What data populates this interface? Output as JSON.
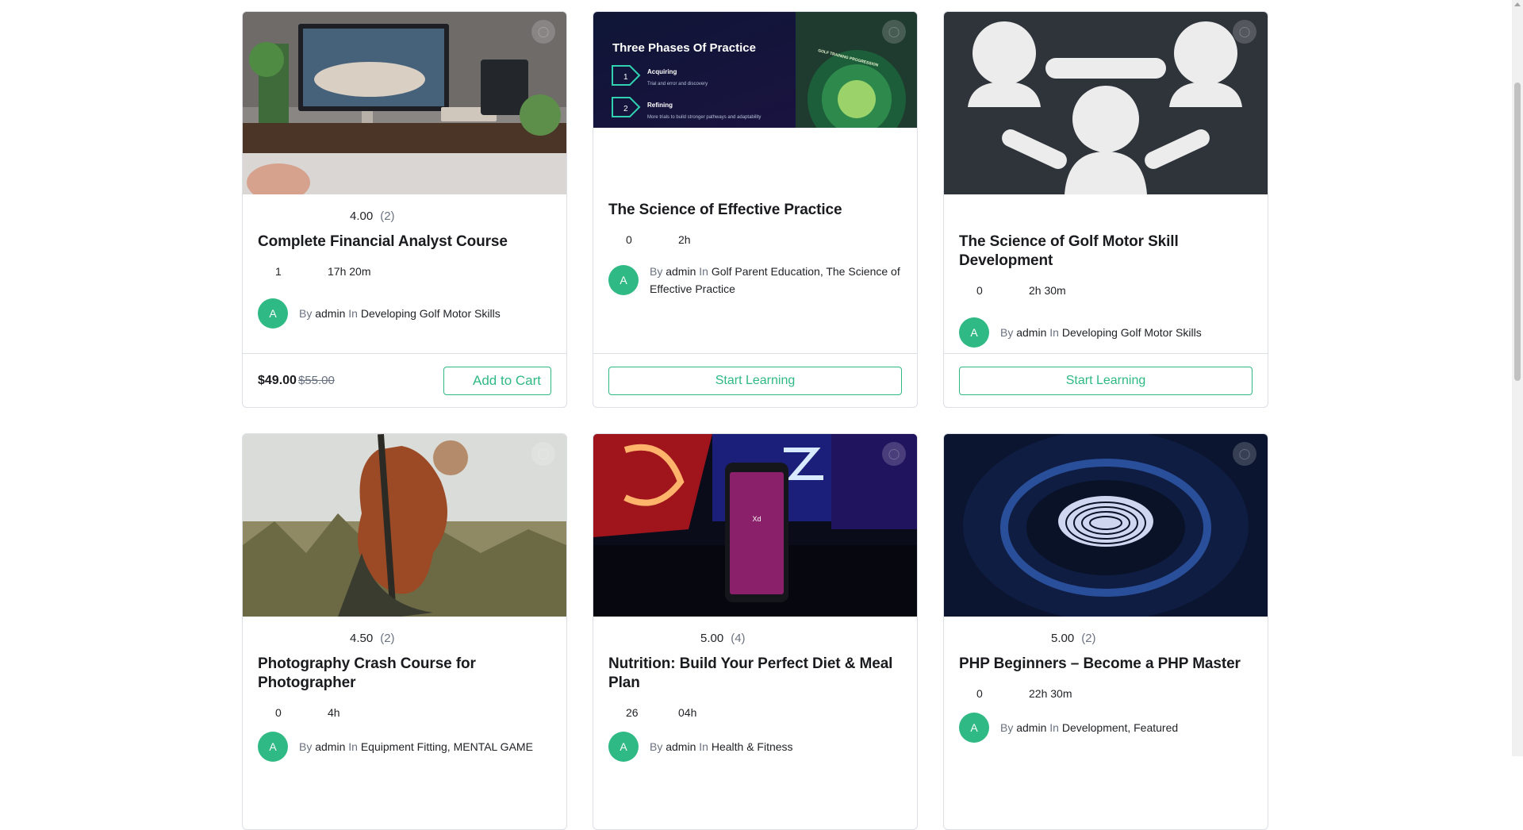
{
  "courses": [
    {
      "rating": "4.00",
      "rating_count": "(2)",
      "title": "Complete Financial Analyst Course",
      "enrolled": "1",
      "duration": "17h 20m",
      "avatar": "A",
      "by": "By",
      "author": "admin",
      "in": "In",
      "categories": "Developing Golf Motor Skills",
      "price": "$49.00",
      "price_old": "$55.00",
      "action": "Add to Cart"
    },
    {
      "rating": "",
      "rating_count": "",
      "title": "The Science of Effective Practice",
      "enrolled": "0",
      "duration": "2h",
      "avatar": "A",
      "by": "By",
      "author": "admin",
      "in": "In",
      "categories": "Golf Parent Education, The Science of Effective Practice",
      "action": "Start Learning",
      "thumb_text": {
        "heading": "Three Phases Of Practice",
        "step1_num": "1",
        "step1_title": "Acquiring",
        "step1_desc": "Trial and error and discovery",
        "step2_num": "2",
        "step2_title": "Refining",
        "step2_desc": "More trials to build stronger pathways and adaptability",
        "badge": "GOLF TRAINING PROGRESSION"
      }
    },
    {
      "rating": "",
      "rating_count": "",
      "title": "The Science of Golf Motor Skill Development",
      "enrolled": "0",
      "duration": "2h 30m",
      "avatar": "A",
      "by": "By",
      "author": "admin",
      "in": "In",
      "categories": "Developing Golf Motor Skills",
      "action": "Start Learning"
    },
    {
      "rating": "4.50",
      "rating_count": "(2)",
      "title": "Photography Crash Course for Photographer",
      "enrolled": "0",
      "duration": "4h",
      "avatar": "A",
      "by": "By",
      "author": "admin",
      "in": "In",
      "categories": "Equipment Fitting, MENTAL GAME"
    },
    {
      "rating": "5.00",
      "rating_count": "(4)",
      "title": "Nutrition: Build Your Perfect Diet & Meal Plan",
      "enrolled": "26",
      "duration": "04h",
      "avatar": "A",
      "by": "By",
      "author": "admin",
      "in": "In",
      "categories": "Health & Fitness",
      "thumb_text": {
        "app_label": "Xd"
      }
    },
    {
      "rating": "5.00",
      "rating_count": "(2)",
      "title": "PHP Beginners – Become a PHP Master",
      "enrolled": "0",
      "duration": "22h 30m",
      "avatar": "A",
      "by": "By",
      "author": "admin",
      "in": "In",
      "categories": "Development, Featured"
    }
  ],
  "colors": {
    "accent": "#2fb984",
    "border": "#dcdfe5",
    "text": "#212327",
    "muted": "#6b7280"
  },
  "icons": [
    "bookmark-icon",
    "user-icon",
    "clock-icon"
  ]
}
